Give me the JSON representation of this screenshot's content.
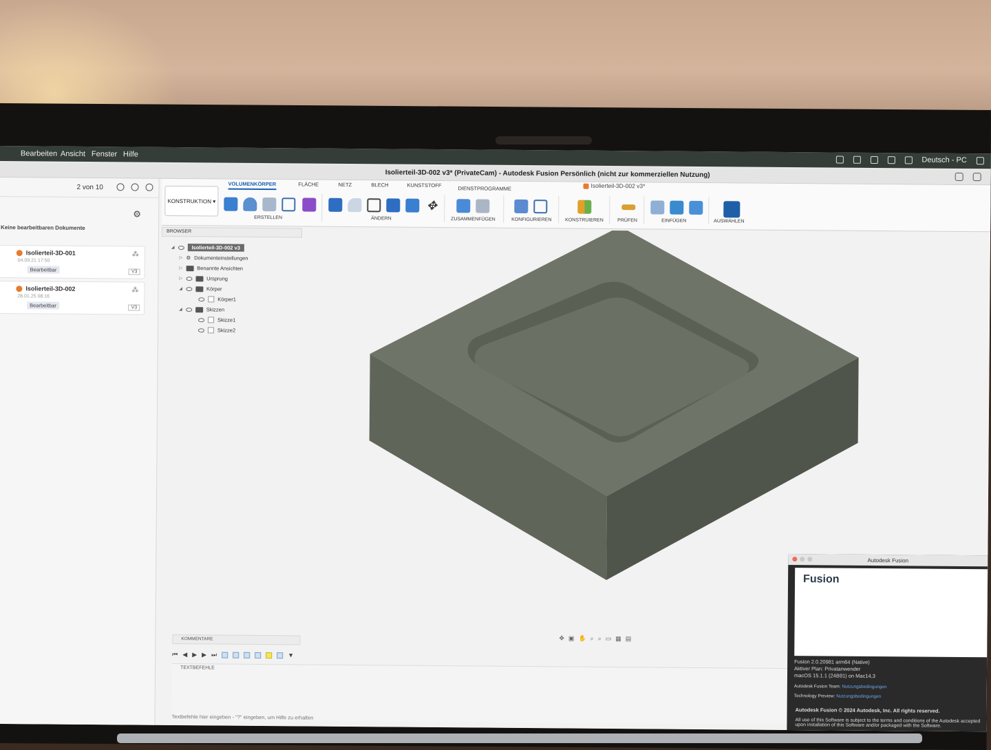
{
  "menubar": {
    "items": [
      "Bearbeiten",
      "Ansicht",
      "Fenster",
      "Hilfe"
    ],
    "right_label": "Deutsch - PC"
  },
  "window": {
    "title": "Isolierteil-3D-002 v3* (PrivateCam) - Autodesk Fusion Persönlich (nicht zur kommerziellen Nutzung)",
    "doc_tab": "Isolierteil-3D-002 v3*"
  },
  "datapanel": {
    "page_count": "2 von 10",
    "section_label": "Keine bearbeitbaren Dokumente",
    "docs": [
      {
        "name": "Isolierteil-3D-001",
        "date": "04.09.21 17:50",
        "badge": "Bearbeitbar",
        "version": "V3"
      },
      {
        "name": "Isolierteil-3D-002",
        "date": "28.01.25 08:16",
        "badge": "Bearbeitbar",
        "version": "V3"
      }
    ]
  },
  "toolbar": {
    "workspace": "KONSTRUKTION",
    "tabs": [
      "VOLUMENKÖRPER",
      "FLÄCHE",
      "NETZ",
      "BLECH",
      "KUNSTSTOFF",
      "DIENSTPROGRAMME"
    ],
    "groups": [
      "ERSTELLEN",
      "ÄNDERN",
      "ZUSAMMENFÜGEN",
      "KONFIGURIEREN",
      "KONSTRUIEREN",
      "PRÜFEN",
      "EINFÜGEN",
      "AUSWÄHLEN"
    ]
  },
  "browser": {
    "header": "BROWSER",
    "root": "Isolierteil-3D-002 v3",
    "nodes": [
      "Dokumenteinstellungen",
      "Benannte Ansichten",
      "Ursprung",
      "Körper",
      "Körper1",
      "Skizzen",
      "Skizze1",
      "Skizze2"
    ]
  },
  "bottom": {
    "comments": "KOMMENTARE",
    "textcmd": "TEXTBEFEHLE",
    "input_placeholder": "Textbefehle hier eingeben - \"?\" eingeben, um Hilfe zu erhalten"
  },
  "about": {
    "window_title": "Autodesk Fusion",
    "product": "Fusion",
    "version": "Fusion 2.0.20981 arm64 (Native)",
    "plan": "Aktiver Plan: Privatanwender",
    "os": "macOS 15.1.1 (24B91) on Mac14,3",
    "team_label": "Autodesk Fusion Team:",
    "team_link": "Nutzungsbedingungen",
    "preview_label": "Technology Preview:",
    "preview_link": "Nutzungsbedingungen",
    "copyright": "Autodesk Fusion © 2024 Autodesk, Inc. All rights reserved.",
    "terms": "All use of this Software is subject to the terms and conditions of the Autodesk accepted upon installation of this Software and/or packaged with the Software."
  },
  "colors": {
    "accent": "#1a5fb4",
    "model_top": "#6f7468",
    "model_left": "#60655a",
    "model_right": "#50554b",
    "doc_dot": "#e87a2f"
  }
}
